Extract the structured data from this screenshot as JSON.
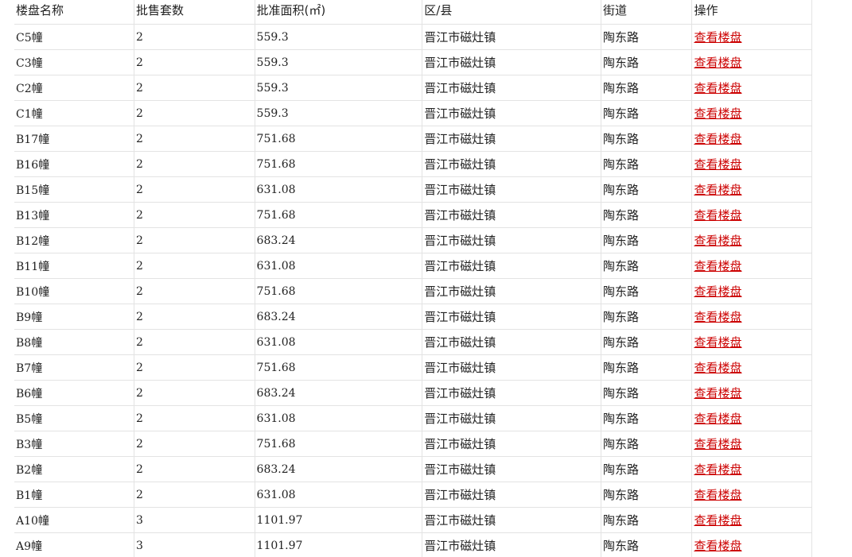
{
  "table": {
    "headers": {
      "name": "楼盘名称",
      "count": "批售套数",
      "area": "批准面积(㎡)",
      "district": "区/县",
      "street": "街道",
      "action": "操作"
    },
    "rows": [
      {
        "name": "C5幢",
        "count": "2",
        "area": "559.3",
        "district": "晋江市磁灶镇",
        "street": "陶东路",
        "action": "查看楼盘"
      },
      {
        "name": "C3幢",
        "count": "2",
        "area": "559.3",
        "district": "晋江市磁灶镇",
        "street": "陶东路",
        "action": "查看楼盘"
      },
      {
        "name": "C2幢",
        "count": "2",
        "area": "559.3",
        "district": "晋江市磁灶镇",
        "street": "陶东路",
        "action": "查看楼盘"
      },
      {
        "name": "C1幢",
        "count": "2",
        "area": "559.3",
        "district": "晋江市磁灶镇",
        "street": "陶东路",
        "action": "查看楼盘"
      },
      {
        "name": "B17幢",
        "count": "2",
        "area": "751.68",
        "district": "晋江市磁灶镇",
        "street": "陶东路",
        "action": "查看楼盘"
      },
      {
        "name": "B16幢",
        "count": "2",
        "area": "751.68",
        "district": "晋江市磁灶镇",
        "street": "陶东路",
        "action": "查看楼盘"
      },
      {
        "name": "B15幢",
        "count": "2",
        "area": "631.08",
        "district": "晋江市磁灶镇",
        "street": "陶东路",
        "action": "查看楼盘"
      },
      {
        "name": "B13幢",
        "count": "2",
        "area": "751.68",
        "district": "晋江市磁灶镇",
        "street": "陶东路",
        "action": "查看楼盘"
      },
      {
        "name": "B12幢",
        "count": "2",
        "area": "683.24",
        "district": "晋江市磁灶镇",
        "street": "陶东路",
        "action": "查看楼盘"
      },
      {
        "name": "B11幢",
        "count": "2",
        "area": "631.08",
        "district": "晋江市磁灶镇",
        "street": "陶东路",
        "action": "查看楼盘"
      },
      {
        "name": "B10幢",
        "count": "2",
        "area": "751.68",
        "district": "晋江市磁灶镇",
        "street": "陶东路",
        "action": "查看楼盘"
      },
      {
        "name": "B9幢",
        "count": "2",
        "area": "683.24",
        "district": "晋江市磁灶镇",
        "street": "陶东路",
        "action": "查看楼盘"
      },
      {
        "name": "B8幢",
        "count": "2",
        "area": "631.08",
        "district": "晋江市磁灶镇",
        "street": "陶东路",
        "action": "查看楼盘"
      },
      {
        "name": "B7幢",
        "count": "2",
        "area": "751.68",
        "district": "晋江市磁灶镇",
        "street": "陶东路",
        "action": "查看楼盘"
      },
      {
        "name": "B6幢",
        "count": "2",
        "area": "683.24",
        "district": "晋江市磁灶镇",
        "street": "陶东路",
        "action": "查看楼盘"
      },
      {
        "name": "B5幢",
        "count": "2",
        "area": "631.08",
        "district": "晋江市磁灶镇",
        "street": "陶东路",
        "action": "查看楼盘"
      },
      {
        "name": "B3幢",
        "count": "2",
        "area": "751.68",
        "district": "晋江市磁灶镇",
        "street": "陶东路",
        "action": "查看楼盘"
      },
      {
        "name": "B2幢",
        "count": "2",
        "area": "683.24",
        "district": "晋江市磁灶镇",
        "street": "陶东路",
        "action": "查看楼盘"
      },
      {
        "name": "B1幢",
        "count": "2",
        "area": "631.08",
        "district": "晋江市磁灶镇",
        "street": "陶东路",
        "action": "查看楼盘"
      },
      {
        "name": "A10幢",
        "count": "3",
        "area": "1101.97",
        "district": "晋江市磁灶镇",
        "street": "陶东路",
        "action": "查看楼盘"
      },
      {
        "name": "A9幢",
        "count": "3",
        "area": "1101.97",
        "district": "晋江市磁灶镇",
        "street": "陶东路",
        "action": "查看楼盘"
      }
    ]
  },
  "colors": {
    "link": "#cc0000",
    "grid": "#e3e3e3",
    "text": "#222222"
  }
}
